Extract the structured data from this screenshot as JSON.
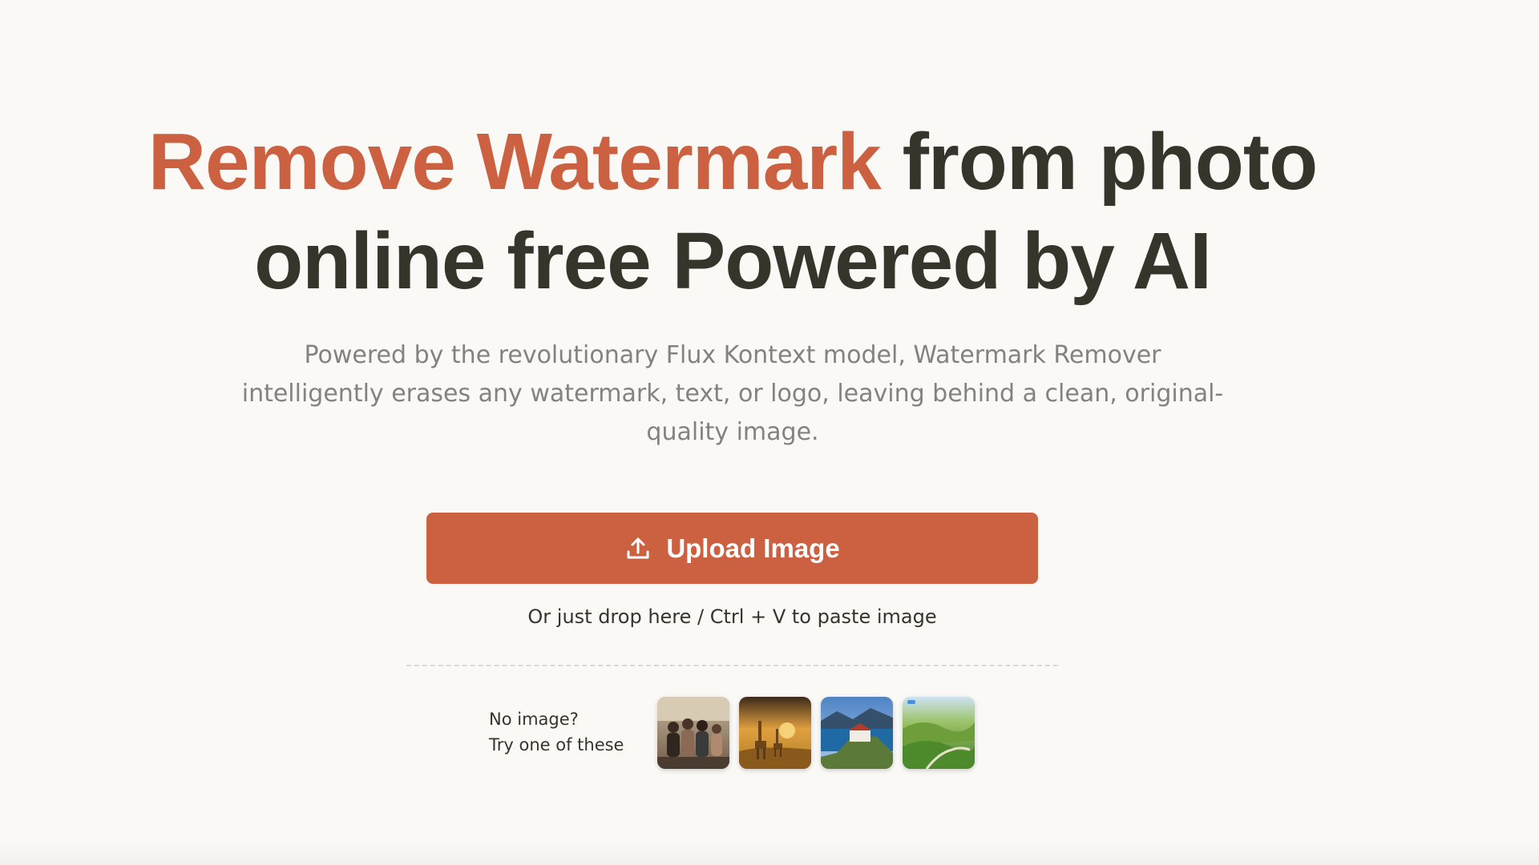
{
  "hero": {
    "headline_accent": "Remove Watermark",
    "headline_rest_line1": " from photo",
    "headline_line2": "online free Powered by AI",
    "subtext": "Powered by the revolutionary Flux Kontext model, Watermark Remover intelligently erases any watermark, text, or logo, leaving behind a clean, original-quality image."
  },
  "upload": {
    "button_label": "Upload Image",
    "button_icon": "upload-icon",
    "drop_hint": "Or just drop here / Ctrl + V to paste image"
  },
  "samples": {
    "label_line1": "No image?",
    "label_line2": "Try one of these",
    "thumbnails": [
      {
        "subject": "group-of-people"
      },
      {
        "subject": "giraffes-savanna"
      },
      {
        "subject": "castle-lake"
      },
      {
        "subject": "green-hills-valley"
      }
    ]
  },
  "colors": {
    "accent": "#cc6142",
    "heading": "#36352b",
    "muted": "#83827e",
    "background": "#faf9f6"
  }
}
